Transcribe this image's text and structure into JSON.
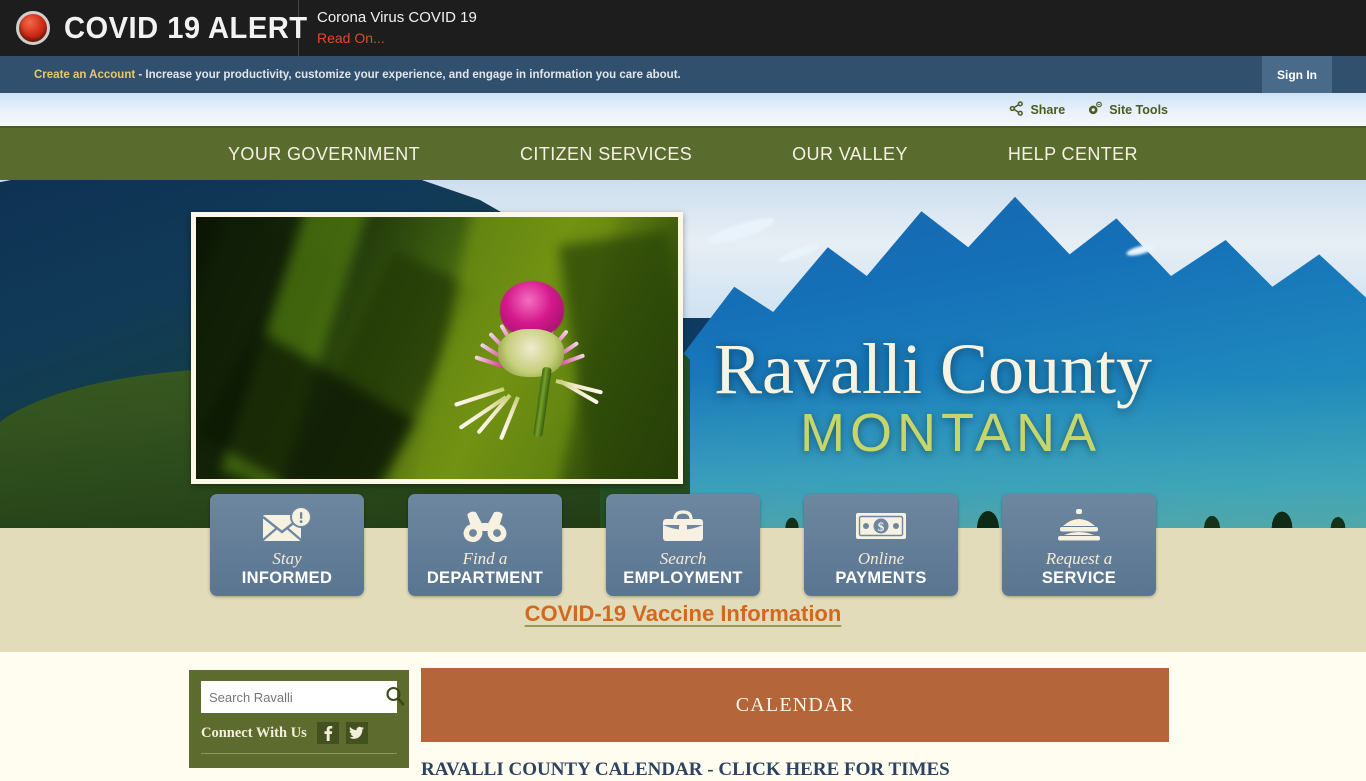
{
  "alert": {
    "badge_icon": "red-alert-dot",
    "title": "COVID 19 ALERT",
    "headline": "Corona Virus COVID 19",
    "read_on": "Read On..."
  },
  "account_bar": {
    "create_link": "Create an Account",
    "message": " - Increase your productivity, customize your experience, and engage in information you care about.",
    "sign_in": "Sign In"
  },
  "tools_bar": {
    "share": "Share",
    "site_tools": "Site Tools"
  },
  "nav": {
    "items": [
      {
        "label": "YOUR GOVERNMENT"
      },
      {
        "label": "CITIZEN SERVICES"
      },
      {
        "label": "OUR VALLEY"
      },
      {
        "label": "HELP CENTER"
      }
    ],
    "bar_color": "#5a6b2e"
  },
  "hero": {
    "title": "Ravalli County",
    "subtitle": "MONTANA",
    "title_color": "#f7f3e3",
    "subtitle_color": "#c7d66b",
    "slide_alt": "thistle-flower-photo"
  },
  "quick_links": [
    {
      "icon": "envelope-alert-icon",
      "line1": "Stay",
      "line2": "INFORMED"
    },
    {
      "icon": "binoculars-icon",
      "line1": "Find a",
      "line2": "DEPARTMENT"
    },
    {
      "icon": "briefcase-icon",
      "line1": "Search",
      "line2": "EMPLOYMENT"
    },
    {
      "icon": "dollar-bill-icon",
      "line1": "Online",
      "line2": "PAYMENTS"
    },
    {
      "icon": "service-bell-icon",
      "line1": "Request a",
      "line2": "SERVICE"
    }
  ],
  "vaccine_link": {
    "label": "COVID-19 Vaccine Information",
    "color": "#d2691e"
  },
  "search": {
    "placeholder": "Search Ravalli",
    "value": "",
    "icon": "magnifier-icon",
    "connect_label": "Connect With Us",
    "social": [
      {
        "icon": "facebook-icon",
        "glyph": "f"
      },
      {
        "icon": "twitter-icon",
        "glyph": "t"
      }
    ],
    "panel_color": "#5d6b2e"
  },
  "calendar": {
    "heading": "CALENDAR",
    "heading_color": "#b4653a",
    "items": [
      "RAVALLI COUNTY CALENDAR - CLICK HERE FOR TIMES"
    ]
  },
  "colors": {
    "alert_bg": "#1d1d1d",
    "account_bg": "#31506e",
    "nav_green": "#5a6b2e",
    "tan_band": "#e3dcba",
    "page_bg": "#fffdf0"
  }
}
